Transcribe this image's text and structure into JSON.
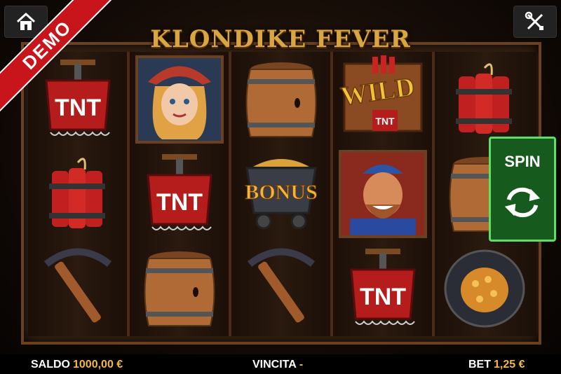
{
  "game": {
    "title": "KLONDIKE FEVER",
    "mode_badge": "DEMO"
  },
  "controls": {
    "spin_label": "SPIN"
  },
  "icons": {
    "home": "home-icon",
    "settings": "tools-icon",
    "spin": "refresh-icon"
  },
  "status": {
    "balance_label": "SALDO",
    "balance_value": "1000,00 €",
    "win_label": "VINCITA",
    "win_value": "-",
    "bet_label": "BET",
    "bet_value": "1,25 €"
  },
  "reels": [
    [
      "tnt-plunger",
      "dynamite",
      "pickaxe"
    ],
    [
      "woman",
      "tnt-plunger",
      "barrel"
    ],
    [
      "barrel",
      "bonus-cart",
      "pickaxe"
    ],
    [
      "wild",
      "miner",
      "tnt-plunger"
    ],
    [
      "dynamite",
      "barrel",
      "gold-pan"
    ]
  ],
  "symbol_text": {
    "tnt": "TNT",
    "wild": "WILD",
    "bonus": "BONUS"
  },
  "colors": {
    "spin_green": "#175a1d",
    "demo_red": "#c8141b",
    "accent_gold": "#f5b942"
  }
}
